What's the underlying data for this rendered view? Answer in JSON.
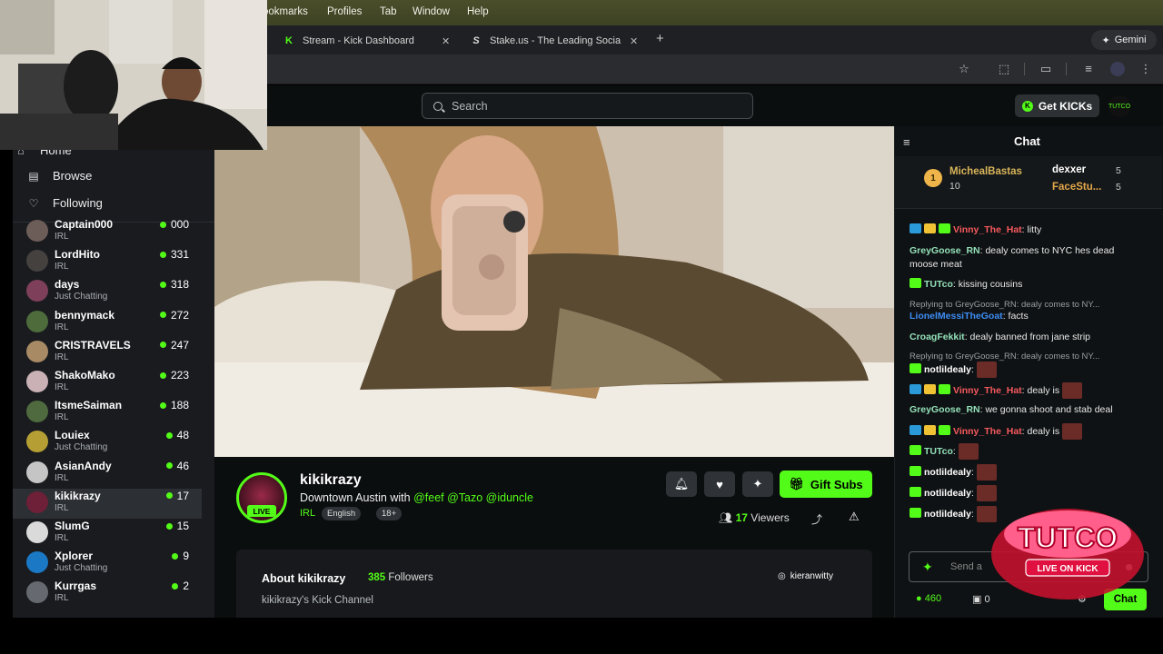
{
  "menubar": {
    "items": [
      "ookmarks",
      "Profiles",
      "Tab",
      "Window",
      "Help"
    ]
  },
  "browser": {
    "tabs": [
      {
        "title": "Stream - Kick Dashboard",
        "favicon": "K"
      },
      {
        "title": "Stake.us - The Leading Socia",
        "favicon": "S"
      }
    ],
    "gemini_label": "Gemini"
  },
  "kick": {
    "search_placeholder": "Search",
    "get_kicks_label": "Get KICKs",
    "user_avatar_text": "TUTCO"
  },
  "sidebar": {
    "nav": [
      {
        "label": "Home",
        "icon": "home-icon"
      },
      {
        "label": "Browse",
        "icon": "browse-icon"
      },
      {
        "label": "Following",
        "icon": "heart-icon"
      }
    ],
    "channels": [
      {
        "name": "Captain000",
        "category": "IRL",
        "viewers": "000",
        "color": "#6d5d58"
      },
      {
        "name": "LordHito",
        "category": "IRL",
        "viewers": "331",
        "color": "#44413f"
      },
      {
        "name": "days",
        "category": "Just Chatting",
        "viewers": "318",
        "color": "#7d3f59"
      },
      {
        "name": "bennymack",
        "category": "IRL",
        "viewers": "272",
        "color": "#4d6b3b"
      },
      {
        "name": "CRISTRAVELS",
        "category": "IRL",
        "viewers": "247",
        "color": "#a88a64"
      },
      {
        "name": "ShakoMako",
        "category": "IRL",
        "viewers": "223",
        "color": "#c9b1b6"
      },
      {
        "name": "ItsmeSaiman",
        "category": "IRL",
        "viewers": "188",
        "color": "#4e6a3e"
      },
      {
        "name": "Louiex",
        "category": "Just Chatting",
        "viewers": "48",
        "color": "#b59f34"
      },
      {
        "name": "AsianAndy",
        "category": "IRL",
        "viewers": "46",
        "color": "#c5c5c5"
      },
      {
        "name": "kikikrazy",
        "category": "IRL",
        "viewers": "17",
        "color": "#6d2038"
      },
      {
        "name": "SlumG",
        "category": "IRL",
        "viewers": "15",
        "color": "#dadada"
      },
      {
        "name": "Xplorer",
        "category": "Just Chatting",
        "viewers": "9",
        "color": "#1b78c4"
      },
      {
        "name": "Kurrgas",
        "category": "IRL",
        "viewers": "2",
        "color": "#666a70"
      }
    ]
  },
  "stream": {
    "channel_name": "kikikrazy",
    "live_label": "LIVE",
    "title_prefix": "Downtown Austin with",
    "title_mentions": "@feef @Tazo @iduncle",
    "category": "IRL",
    "tags": [
      "English",
      "18+"
    ],
    "gift_subs_label": "Gift Subs",
    "viewers_count": "17",
    "viewers_label": "Viewers",
    "about_title": "About kikikrazy",
    "followers_count": "385",
    "followers_label": "Followers",
    "about_desc": "kikikrazy's Kick Channel",
    "instagram": "kieranwitty"
  },
  "chat": {
    "title": "Chat",
    "leaderboard": [
      {
        "name": "MichealBastas",
        "amount": "10"
      },
      {
        "name": "dexxer",
        "amount": "5"
      },
      {
        "name": "FaceStu...",
        "amount": "5"
      }
    ],
    "messages": [
      {
        "user": "Vinny_The_Hat",
        "color": "#f6595e",
        "text": ": litty"
      },
      {
        "user": "GreyGoose_RN",
        "color": "#93e0b9",
        "text": ": dealy comes to NYC hes dead"
      },
      {
        "user": "",
        "color": "#fff",
        "text": "moose meat"
      },
      {
        "user": "TUTco",
        "color": "#93e0b9",
        "text": ": kissing cousins"
      },
      {
        "reply": "Replying to GreyGoose_RN: dealy comes to NY..."
      },
      {
        "user": "LionelMessiTheGoat",
        "color": "#3d8cf3",
        "text": ": facts"
      },
      {
        "user": "CroagFekkit",
        "color": "#93e0b9",
        "text": ": dealy banned from jane strip"
      },
      {
        "reply": "Replying to GreyGoose_RN: dealy comes to NY..."
      },
      {
        "user": "notlildealy",
        "color": "#fff",
        "text": ":"
      },
      {
        "user": "Vinny_The_Hat",
        "color": "#f6595e",
        "text": ": dealy is"
      },
      {
        "user": "GreyGoose_RN",
        "color": "#93e0b9",
        "text": ": we gonna shoot and stab deal"
      },
      {
        "user": "Vinny_The_Hat",
        "color": "#f6595e",
        "text": ": dealy is"
      },
      {
        "user": "TUTco",
        "color": "#93e0b9",
        "text": ":"
      },
      {
        "user": "notlildealy",
        "color": "#fff",
        "text": ":"
      },
      {
        "user": "notlildealy",
        "color": "#fff",
        "text": ":"
      },
      {
        "user": "notlildealy",
        "color": "#fff",
        "text": ":"
      }
    ],
    "input_placeholder": "Send a",
    "kicks_balance": "460",
    "gifts_count": "0",
    "send_label": "Chat",
    "overlay_text": "TUTCO",
    "overlay_sub": "LIVE ON KICK"
  }
}
